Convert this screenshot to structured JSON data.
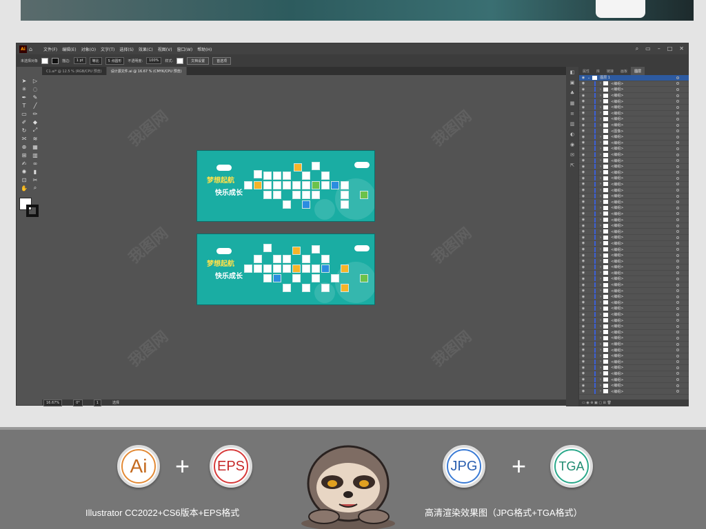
{
  "app": {
    "logo": "Ai"
  },
  "menu": [
    "文件(F)",
    "编辑(E)",
    "对象(O)",
    "文字(T)",
    "选择(S)",
    "效果(C)",
    "视图(V)",
    "窗口(W)",
    "帮助(H)"
  ],
  "control_bar": {
    "selection": "未选择对象",
    "stroke_label": "描边:",
    "stroke_value": "1 pt",
    "brush_label": "等比",
    "points_label": "5 点圆形",
    "opacity_label": "不透明度:",
    "opacity_value": "100%",
    "style_label": "样式:",
    "doc_setup": "文档设置",
    "prefs": "首选项"
  },
  "tabs": [
    {
      "label": "C1.ai* @ 12.5 % (RGB/CPU 预览)",
      "active": false
    },
    {
      "label": "设计源文件.ai @ 16.67 % (CMYK/CPU 预览)",
      "active": true
    }
  ],
  "artboard": {
    "line1": "梦想起航",
    "line2": "快乐成长"
  },
  "status": {
    "zoom": "16.67%",
    "rotation": "0°",
    "page": "1",
    "tool": "选择"
  },
  "layers_panel": {
    "tabs": [
      "属性",
      "库",
      "链接",
      "画板",
      "图层"
    ],
    "active_tab": "图层",
    "layer_name": "图层 1",
    "group_label": "<编组>",
    "image_label": "<图像>"
  },
  "watermark": "我图网",
  "footer": {
    "badges": [
      "Ai",
      "EPS",
      "JPG",
      "TGA"
    ],
    "plus": "+",
    "caption_left": "Illustrator CC2022+CS6版本+EPS格式",
    "caption_right": "高清渲染效果图（JPG格式+TGA格式）"
  }
}
